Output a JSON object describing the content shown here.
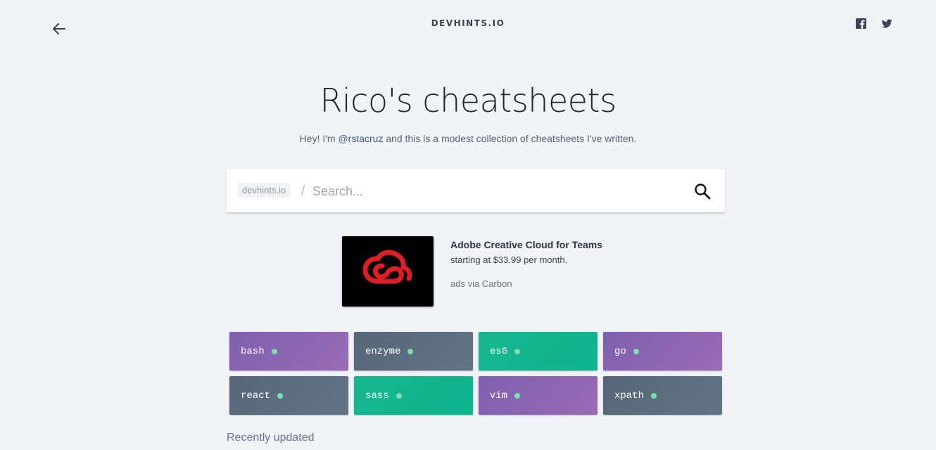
{
  "header": {
    "brand": "DEVHINTS.IO",
    "back_icon": "arrow-left-icon",
    "social": [
      {
        "name": "facebook",
        "icon": "facebook-icon"
      },
      {
        "name": "twitter",
        "icon": "twitter-icon"
      }
    ]
  },
  "hero": {
    "title": "Rico's cheatsheets",
    "intro_before": "Hey! I'm ",
    "intro_link": "@rstacruz",
    "intro_after": " and this is a modest collection of cheatsheets I've written."
  },
  "search": {
    "prefix": "devhints.io",
    "separator": "/",
    "placeholder": "Search...",
    "value": "",
    "icon": "search-icon"
  },
  "ad": {
    "image_icon": "adobe-creative-cloud-logo",
    "title": "Adobe Creative Cloud for Teams",
    "description": "starting at $33.99 per month.",
    "via": "ads via Carbon"
  },
  "sheets": [
    {
      "label": "bash",
      "color": "purple"
    },
    {
      "label": "enzyme",
      "color": "slate"
    },
    {
      "label": "es6",
      "color": "green"
    },
    {
      "label": "go",
      "color": "purple"
    },
    {
      "label": "react",
      "color": "slate"
    },
    {
      "label": "sass",
      "color": "green"
    },
    {
      "label": "vim",
      "color": "purple"
    },
    {
      "label": "xpath",
      "color": "slate"
    }
  ],
  "colors": {
    "purple": "#8a64b2",
    "slate": "#5c6d7f",
    "green": "#13b58f",
    "dot": "#7ddfa9",
    "background": "#f2f3f6"
  },
  "sections": {
    "recently_updated": "Recently updated"
  }
}
